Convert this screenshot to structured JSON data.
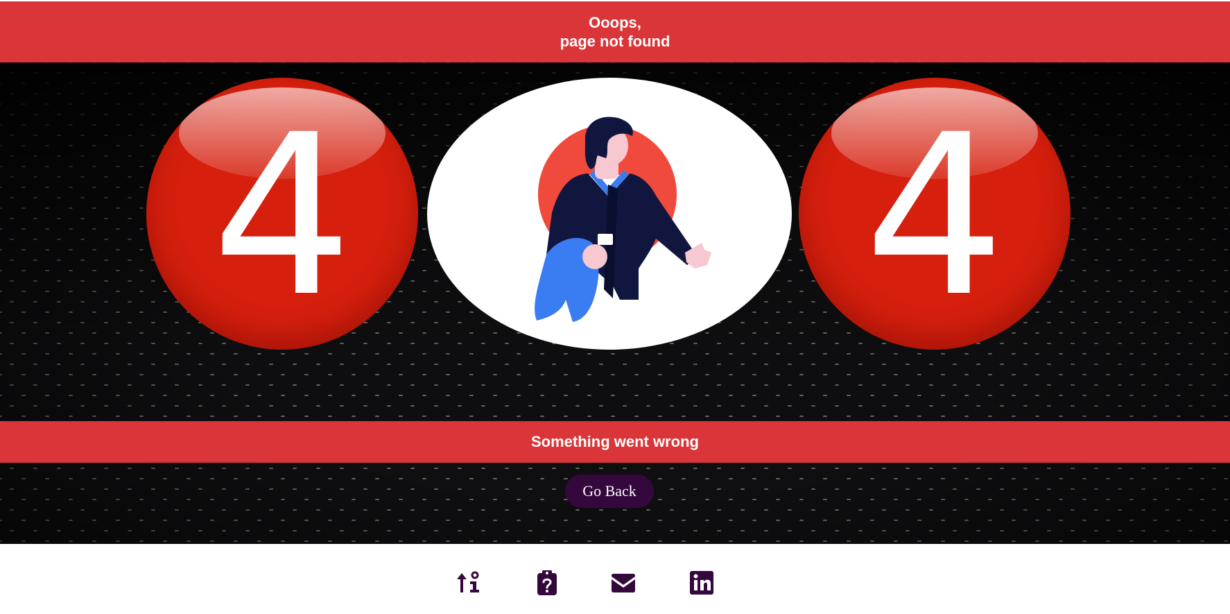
{
  "header": {
    "line1": "Ooops,",
    "line2": "page not found"
  },
  "hero": {
    "left_digit": "4",
    "right_digit": "4",
    "illustration": "confused-man-illustration"
  },
  "message": "Something went wrong",
  "go_back_label": "Go Back",
  "footer": {
    "icons": [
      "arrow-info-icon",
      "clipboard-question-icon",
      "envelope-icon",
      "linkedin-icon"
    ]
  },
  "colors": {
    "banner": "#da3538",
    "ball": "#d61f0d",
    "button": "#34083c",
    "footer_icon": "#34083c"
  }
}
